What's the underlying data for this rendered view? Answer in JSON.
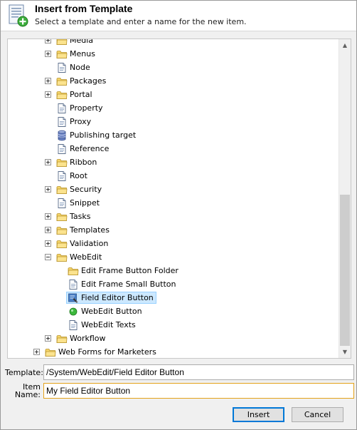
{
  "dialog": {
    "title": "Insert from Template",
    "subtitle": "Select a template and enter a name for the new item."
  },
  "tree": {
    "items": [
      {
        "label": "Media",
        "icon": "folder-icon",
        "toggle": "plus",
        "indent": 1
      },
      {
        "label": "Menus",
        "icon": "folder-icon",
        "toggle": "plus",
        "indent": 1
      },
      {
        "label": "Node",
        "icon": "document-icon",
        "toggle": "none",
        "indent": 1
      },
      {
        "label": "Packages",
        "icon": "folder-icon",
        "toggle": "plus",
        "indent": 1
      },
      {
        "label": "Portal",
        "icon": "folder-icon",
        "toggle": "plus",
        "indent": 1
      },
      {
        "label": "Property",
        "icon": "document-icon",
        "toggle": "none",
        "indent": 1
      },
      {
        "label": "Proxy",
        "icon": "document-icon",
        "toggle": "none",
        "indent": 1
      },
      {
        "label": "Publishing target",
        "icon": "database-icon",
        "toggle": "none",
        "indent": 1
      },
      {
        "label": "Reference",
        "icon": "document-icon",
        "toggle": "none",
        "indent": 1
      },
      {
        "label": "Ribbon",
        "icon": "folder-icon",
        "toggle": "plus",
        "indent": 1
      },
      {
        "label": "Root",
        "icon": "document-icon",
        "toggle": "none",
        "indent": 1
      },
      {
        "label": "Security",
        "icon": "folder-icon",
        "toggle": "plus",
        "indent": 1
      },
      {
        "label": "Snippet",
        "icon": "document-icon",
        "toggle": "none",
        "indent": 1
      },
      {
        "label": "Tasks",
        "icon": "folder-icon",
        "toggle": "plus",
        "indent": 1
      },
      {
        "label": "Templates",
        "icon": "folder-icon",
        "toggle": "plus",
        "indent": 1
      },
      {
        "label": "Validation",
        "icon": "folder-icon",
        "toggle": "plus",
        "indent": 1
      },
      {
        "label": "WebEdit",
        "icon": "folder-icon",
        "toggle": "minus",
        "indent": 1
      },
      {
        "label": "Edit Frame Button Folder",
        "icon": "folder-icon",
        "toggle": "none",
        "indent": 2
      },
      {
        "label": "Edit Frame Small Button",
        "icon": "document-icon",
        "toggle": "none",
        "indent": 2
      },
      {
        "label": "Field Editor Button",
        "icon": "field-editor-icon",
        "toggle": "none",
        "indent": 2,
        "selected": true
      },
      {
        "label": "WebEdit Button",
        "icon": "green-dot-icon",
        "toggle": "none",
        "indent": 2
      },
      {
        "label": "WebEdit Texts",
        "icon": "document-icon",
        "toggle": "none",
        "indent": 2
      },
      {
        "label": "Workflow",
        "icon": "folder-icon",
        "toggle": "plus",
        "indent": 1
      },
      {
        "label": "Web Forms for Marketers",
        "icon": "folder-icon",
        "toggle": "plus",
        "indent": 0
      }
    ]
  },
  "form": {
    "template_label": "Template:",
    "template_value": "/System/WebEdit/Field Editor Button",
    "name_label_line1": "Item",
    "name_label_line2": "Name:",
    "name_value": "My Field Editor Button"
  },
  "buttons": {
    "insert": "Insert",
    "cancel": "Cancel"
  },
  "colors": {
    "selection_bg": "#cce8ff",
    "selection_border": "#99d1ff",
    "folder_yellow": "#f5d56a",
    "focus_border": "#e3a21a",
    "primary_border": "#0078d7"
  }
}
